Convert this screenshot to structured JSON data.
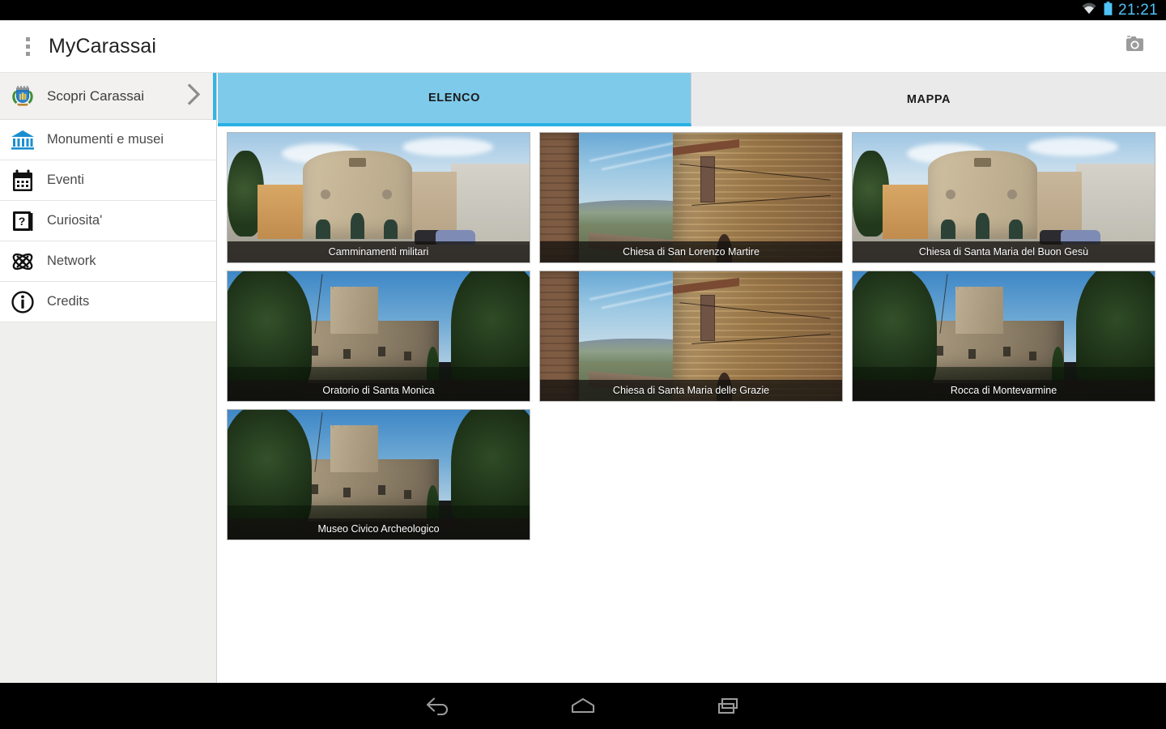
{
  "statusbar": {
    "time": "21:21",
    "wifi_icon": "wifi-icon",
    "battery_icon": "battery-icon",
    "accent_color": "#4fc3f7"
  },
  "appbar": {
    "title": "MyCarassai",
    "overflow_icon": "overflow-menu-icon",
    "camera_icon": "camera-icon"
  },
  "sidebar": {
    "items": [
      {
        "label": "Scopri Carassai",
        "icon": "crest-icon",
        "selected": true,
        "chevron": "chevron-right-icon"
      },
      {
        "label": "Monumenti e musei",
        "icon": "museum-icon",
        "selected": false
      },
      {
        "label": "Eventi",
        "icon": "calendar-icon",
        "selected": false
      },
      {
        "label": "Curiosita'",
        "icon": "question-book-icon",
        "selected": false
      },
      {
        "label": "Network",
        "icon": "atom-icon",
        "selected": false
      },
      {
        "label": "Credits",
        "icon": "info-icon",
        "selected": false
      }
    ]
  },
  "main": {
    "tabs": [
      {
        "label": "ELENCO",
        "active": true
      },
      {
        "label": "MAPPA",
        "active": false
      }
    ],
    "active_tab_color": "#7ecaea",
    "active_tab_underline": "#29b0e5",
    "cards": [
      {
        "caption": "Camminamenti militari",
        "scene": "A"
      },
      {
        "caption": "Chiesa di San Lorenzo Martire",
        "scene": "B"
      },
      {
        "caption": "Chiesa di Santa Maria del Buon Gesù",
        "scene": "A"
      },
      {
        "caption": "Oratorio di Santa Monica",
        "scene": "C"
      },
      {
        "caption": "Chiesa di Santa Maria delle Grazie",
        "scene": "B"
      },
      {
        "caption": "Rocca di Montevarmine",
        "scene": "C"
      },
      {
        "caption": "Museo Civico Archeologico",
        "scene": "C"
      }
    ]
  },
  "navbar": {
    "buttons": [
      {
        "name": "back-icon"
      },
      {
        "name": "home-icon"
      },
      {
        "name": "recents-icon"
      }
    ]
  }
}
